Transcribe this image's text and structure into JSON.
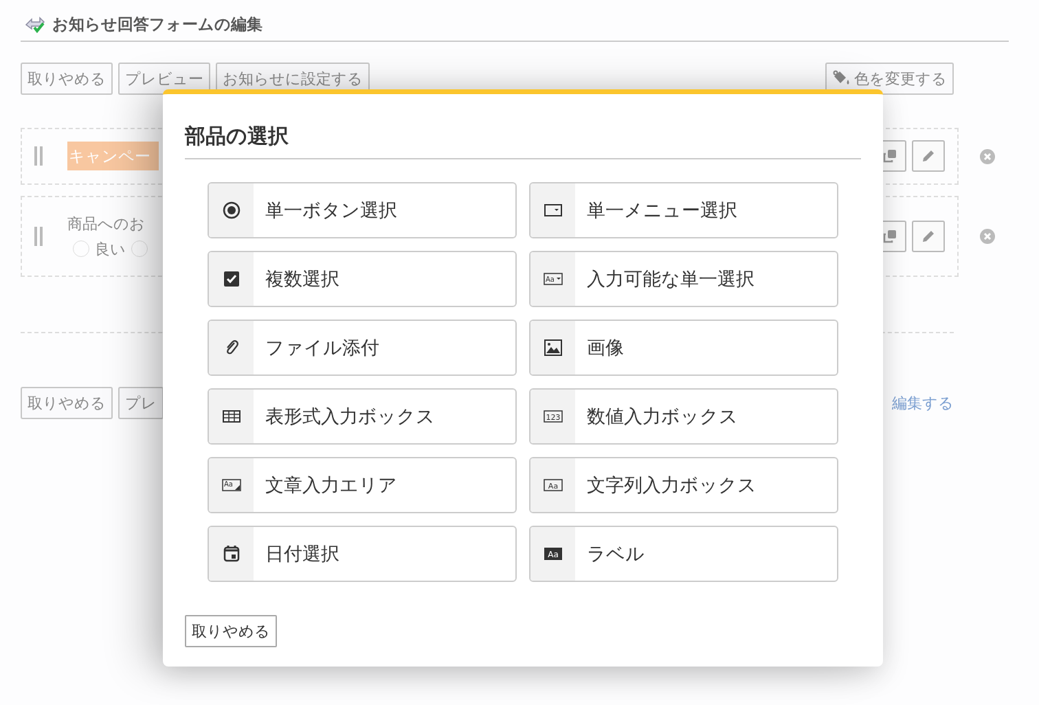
{
  "page": {
    "title": "お知らせ回答フォームの編集",
    "toolbar": [
      "取りやめる",
      "プレビュー",
      "お知らせに設定する"
    ],
    "color_button": "色を変更する",
    "fields": [
      {
        "kind": "heading",
        "text": "キャンペー"
      },
      {
        "kind": "question",
        "text": "商品へのお",
        "options": [
          {
            "label": "良い",
            "selected": false
          },
          {
            "selected": false
          }
        ]
      }
    ],
    "bottom_toolbar": [
      "取りやめる",
      "プレ"
    ],
    "edit_link": "編集する"
  },
  "modal": {
    "title": "部品の選択",
    "parts": [
      {
        "label": "単一ボタン選択",
        "kind": "radio"
      },
      {
        "label": "単一メニュー選択",
        "kind": "dropdown"
      },
      {
        "label": "複数選択",
        "kind": "checkbox"
      },
      {
        "label": "入力可能な単一選択",
        "kind": "combo",
        "icon_text": "Aa"
      },
      {
        "label": "ファイル添付",
        "kind": "attachment"
      },
      {
        "label": "画像",
        "kind": "image"
      },
      {
        "label": "表形式入力ボックス",
        "kind": "table"
      },
      {
        "label": "数値入力ボックス",
        "kind": "number",
        "icon_text": "123"
      },
      {
        "label": "文章入力エリア",
        "kind": "textarea",
        "icon_text": "Aa"
      },
      {
        "label": "文字列入力ボックス",
        "kind": "textbox",
        "icon_text": "Aa"
      },
      {
        "label": "日付選択",
        "kind": "date"
      },
      {
        "label": "ラベル",
        "kind": "label",
        "icon_text": "Aa"
      }
    ],
    "cancel": "取りやめる"
  }
}
